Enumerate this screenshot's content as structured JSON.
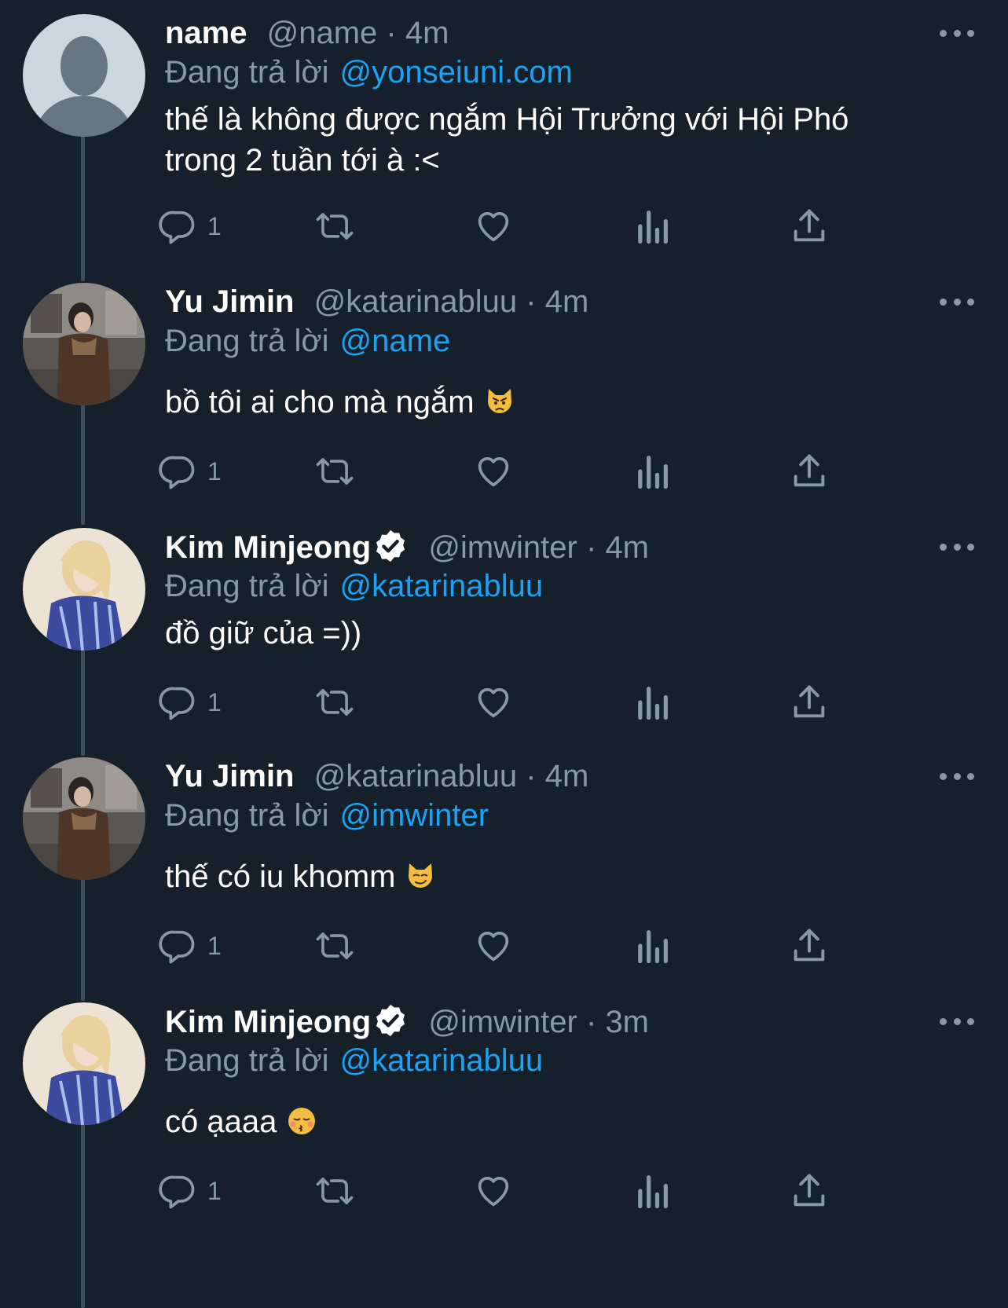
{
  "colors": {
    "background": "#15202b",
    "primary_text": "#ffffff",
    "secondary_text": "#8899a6",
    "link": "#1da1f2",
    "thread_line": "#3d4f5f"
  },
  "reply_prefix": "Đang trả lời",
  "tweets": [
    {
      "display_name": "name",
      "verified": false,
      "handle": "@name",
      "separator": "·",
      "time": "4m",
      "reply_to": "@yonseiuni.com",
      "text": "thế là không được ngắm Hội Trưởng với Hội Phó\ntrong 2 tuần tới à :<",
      "emoji": "",
      "reply_count": "1",
      "avatar": "default-avatar"
    },
    {
      "display_name": "Yu Jimin",
      "verified": false,
      "handle": "@katarinabluu",
      "separator": "·",
      "time": "4m",
      "reply_to": "@name",
      "text": "bồ tôi ai cho mà ngắm",
      "emoji": "pouting-cat-emoji",
      "reply_count": "1",
      "avatar": "street-photo-avatar"
    },
    {
      "display_name": "Kim Minjeong",
      "verified": true,
      "handle": "@imwinter",
      "separator": "·",
      "time": "4m",
      "reply_to": "@katarinabluu",
      "text": "đồ giữ của =))",
      "emoji": "",
      "reply_count": "1",
      "avatar": "blonde-portrait-avatar"
    },
    {
      "display_name": "Yu Jimin",
      "verified": false,
      "handle": "@katarinabluu",
      "separator": "·",
      "time": "4m",
      "reply_to": "@imwinter",
      "text": "thế có iu khomm",
      "emoji": "smirk-cat-emoji",
      "reply_count": "1",
      "avatar": "street-photo-avatar"
    },
    {
      "display_name": "Kim Minjeong",
      "verified": true,
      "handle": "@imwinter",
      "separator": "·",
      "time": "3m",
      "reply_to": "@katarinabluu",
      "text": "có ạaaa",
      "emoji": "kissing-face-emoji",
      "reply_count": "1",
      "avatar": "blonde-portrait-avatar"
    }
  ]
}
